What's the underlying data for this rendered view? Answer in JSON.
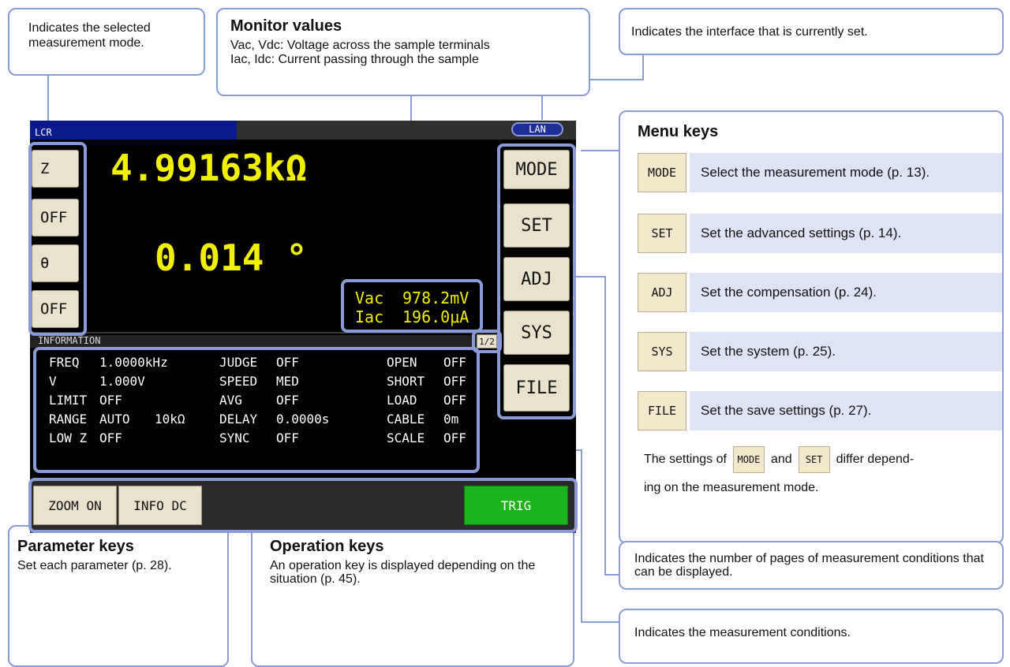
{
  "callouts": {
    "mode": "Indicates the selected measurement mode.",
    "monitor_title": "Monitor values",
    "monitor_line1": "Vac, Vdc: Voltage across the sample terminals",
    "monitor_line2": "Iac, Idc: Current passing through the sample",
    "interface": "Indicates the interface that is currently set.",
    "menu_title": "Menu keys",
    "pages": "Indicates the number of pages of measurement conditions that can be displayed.",
    "conditions": "Indicates the measurement conditions.",
    "param_title": "Parameter keys",
    "param_desc": "Set each parameter (p. 28).",
    "op_title": "Operation keys",
    "op_desc": "An operation key is displayed depending on the situation (p. 45)."
  },
  "menu_items": [
    {
      "key": "MODE",
      "desc": "Select the measurement mode (p. 13)."
    },
    {
      "key": "SET",
      "desc": "Set the advanced settings (p. 14)."
    },
    {
      "key": "ADJ",
      "desc": "Set the compensation (p. 24)."
    },
    {
      "key": "SYS",
      "desc": "Set the system (p. 25)."
    },
    {
      "key": "FILE",
      "desc": "Set the save settings (p. 27)."
    }
  ],
  "menu_note": {
    "part1": "The settings of",
    "key1": "MODE",
    "part2": "and",
    "key2": "SET",
    "part3": "differ depend-",
    "line2": "ing on the measurement mode."
  },
  "screen": {
    "mode_label": "LCR",
    "interface_badge": "LAN",
    "param1": "Z",
    "param1_state": "OFF",
    "param2": "θ",
    "param2_state": "OFF",
    "value1": "4.99163kΩ",
    "value2": "0.014 °",
    "monitor": {
      "v_label": "Vac",
      "v_value": "978.2mV",
      "i_label": "Iac",
      "i_value": "196.0μA"
    },
    "info_header": "INFORMATION",
    "page_indicator": "1/2",
    "menu_buttons": [
      "MODE",
      "SET",
      "ADJ",
      "SYS",
      "FILE"
    ],
    "info_rows": [
      [
        "FREQ",
        "1.0000kHz",
        "",
        "JUDGE",
        "OFF",
        "OPEN",
        "OFF"
      ],
      [
        "V",
        "1.000V",
        "",
        "SPEED",
        "MED",
        "SHORT",
        "OFF"
      ],
      [
        "LIMIT",
        "OFF",
        "",
        "AVG",
        "OFF",
        "LOAD",
        "OFF"
      ],
      [
        "RANGE",
        "AUTO",
        "10kΩ",
        "DELAY",
        "0.0000s",
        "CABLE",
        "0m"
      ],
      [
        "LOW Z",
        "OFF",
        "",
        "SYNC",
        "OFF",
        "SCALE",
        "OFF"
      ]
    ],
    "ops": {
      "zoom": "ZOOM ON",
      "info": "INFO DC",
      "trig": "TRIG"
    }
  },
  "colors": {
    "callout_border": "#8a9ad6",
    "trig": "#1db31d",
    "value": "#f0f000",
    "header_bar": "#0a1a8c"
  }
}
